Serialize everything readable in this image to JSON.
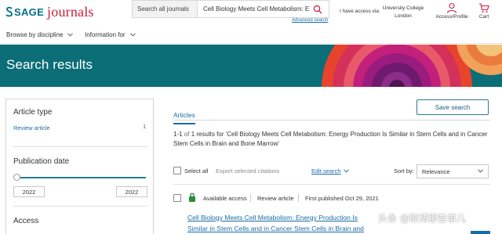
{
  "header": {
    "logo_sage": "SAGE",
    "logo_journals": "journals",
    "search_scope": "Search all journals",
    "search_value": "Cell Biology Meets Cell Metabolism: E...",
    "search_icon": "search-icon",
    "advanced_search": "Advanced search",
    "access_via": "I have access via:",
    "institution_line1": "University College",
    "institution_line2": "London",
    "profile_label": "Access/Profile",
    "profile_icon": "user-icon",
    "cart_label": "Cart",
    "cart_icon": "cart-icon",
    "brand_blue": "#006d8f",
    "brand_red": "#cc1c3a"
  },
  "nav": {
    "browse": "Browse by discipline",
    "info": "Information for"
  },
  "banner": {
    "title": "Search results",
    "background": "#0b6e77"
  },
  "filters": {
    "article_type_title": "Article type",
    "review_article_label": "Review article",
    "review_article_count": "1",
    "publication_date_title": "Publication date",
    "year_from": "2022",
    "year_to": "2022",
    "access_title": "Access"
  },
  "results": {
    "tab_articles": "Articles",
    "save_search": "Save search",
    "summary_range": "1-1",
    "summary_of": "of",
    "summary_count": "1",
    "summary_prefix": "results for ",
    "summary_query": "'Cell Biology Meets Cell Metabolism: Energy Production Is Similar in Stem Cells and in Cancer Stem Cells in Brain and Bone Marrow'",
    "select_all": "Select all",
    "export": "Export selected citations",
    "edit_search": "Edit search",
    "sort_by": "Sort by:",
    "sort_value": "Relevance",
    "items": [
      {
        "access": "Available access",
        "type": "Review article",
        "published": "First published Oct 29, 2021",
        "title": "Cell Biology Meets Cell Metabolism: Energy Production Is Similar in Stem Cells and in Cancer Stem Cells in Brain and Bone Marrow"
      }
    ]
  },
  "watermark": "头条 @硕博那些事儿"
}
